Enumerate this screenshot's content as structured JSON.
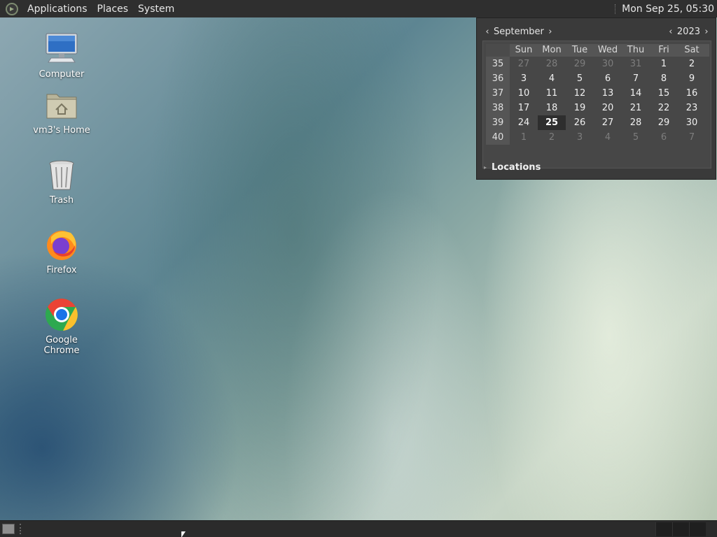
{
  "top_panel": {
    "menus": [
      "Applications",
      "Places",
      "System"
    ],
    "clock": "Mon Sep 25, 05:30"
  },
  "desktop_icons": [
    {
      "label": "Computer",
      "icon": "computer-icon"
    },
    {
      "label": "vm3's Home",
      "icon": "home-folder-icon"
    },
    {
      "label": "Trash",
      "icon": "trash-icon"
    },
    {
      "label": "Firefox",
      "icon": "firefox-icon"
    },
    {
      "label": "Google Chrome",
      "icon": "chrome-icon"
    }
  ],
  "calendar": {
    "month": "September",
    "year": "2023",
    "weekdays": [
      "Sun",
      "Mon",
      "Tue",
      "Wed",
      "Thu",
      "Fri",
      "Sat"
    ],
    "weeks": [
      {
        "week": "35",
        "days": [
          "27",
          "28",
          "29",
          "30",
          "31",
          "1",
          "2"
        ]
      },
      {
        "week": "36",
        "days": [
          "3",
          "4",
          "5",
          "6",
          "7",
          "8",
          "9"
        ]
      },
      {
        "week": "37",
        "days": [
          "10",
          "11",
          "12",
          "13",
          "14",
          "15",
          "16"
        ]
      },
      {
        "week": "38",
        "days": [
          "17",
          "18",
          "19",
          "20",
          "21",
          "22",
          "23"
        ]
      },
      {
        "week": "39",
        "days": [
          "24",
          "25",
          "26",
          "27",
          "28",
          "29",
          "30"
        ]
      },
      {
        "week": "40",
        "days": [
          "1",
          "2",
          "3",
          "4",
          "5",
          "6",
          "7"
        ]
      }
    ],
    "selected_day": "25",
    "locations_label": "Locations"
  },
  "colors": {
    "panel": "#2f2f2f",
    "popup": "#3a3a3a",
    "dim_text": "#7d7d7d"
  }
}
